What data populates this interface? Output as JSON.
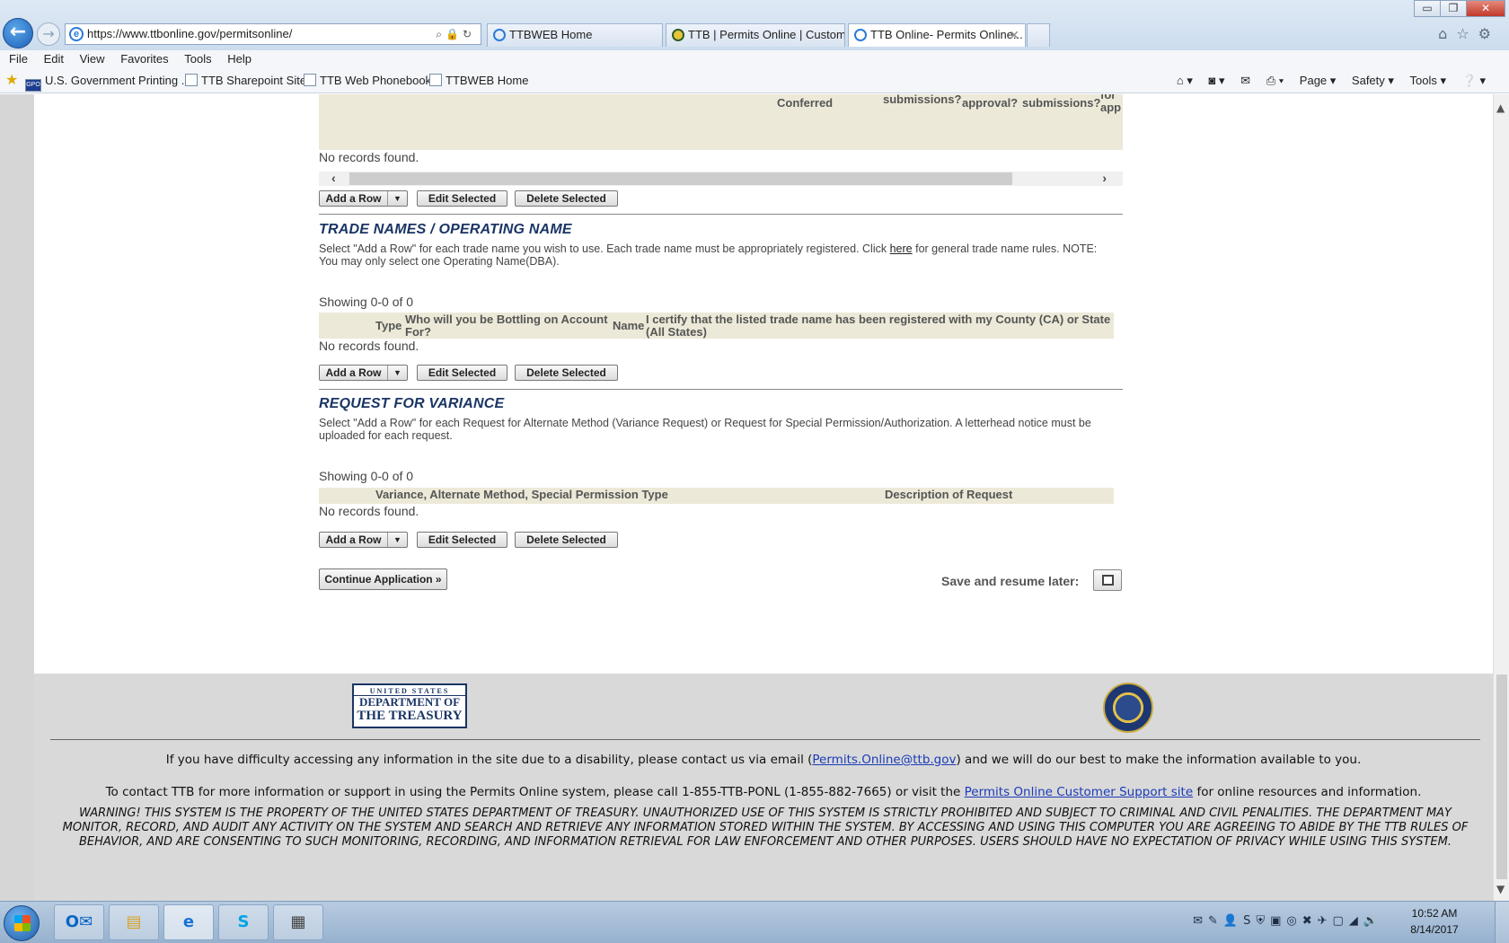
{
  "browser": {
    "url": "https://www.ttbonline.gov/permitsonline/",
    "tabs": [
      {
        "label": "TTBWEB Home"
      },
      {
        "label": "TTB | Permits Online | Custom..."
      },
      {
        "label": "TTB Online- Permits Online..."
      }
    ],
    "menu": [
      "File",
      "Edit",
      "View",
      "Favorites",
      "Tools",
      "Help"
    ],
    "favorites": [
      "U.S. Government Printing ...",
      "TTB Sharepoint Site",
      "TTB Web Phonebook",
      "TTBWEB Home"
    ],
    "command_bar": [
      "Page ▾",
      "Safety ▾",
      "Tools ▾"
    ]
  },
  "top_table": {
    "headers": [
      "Conferred",
      "submissions?",
      "approval?",
      "submissions?",
      "for app"
    ],
    "no_records": "No records found.",
    "add_row": "Add a Row",
    "edit_selected": "Edit Selected",
    "delete_selected": "Delete Selected"
  },
  "trade_names": {
    "title": "TRADE NAMES / OPERATING NAME",
    "desc_before": "Select \"Add a Row\" for each trade name you wish to use. Each trade name must be appropriately registered. Click ",
    "desc_link": "here",
    "desc_after": " for general trade name rules. NOTE: You may only select one Operating Name(DBA).",
    "showing": "Showing 0-0 of 0",
    "columns": [
      "Type",
      "Who will you be Bottling on Account For?",
      "Name",
      "I certify that the listed trade name has been registered with my County (CA) or State (All States)"
    ],
    "no_records": "No records found.",
    "add_row": "Add a Row",
    "edit_selected": "Edit Selected",
    "delete_selected": "Delete Selected"
  },
  "variance": {
    "title": "REQUEST FOR VARIANCE",
    "desc": "Select \"Add a Row\" for each Request for Alternate Method (Variance Request) or Request for Special Permission/Authorization. A letterhead notice must be uploaded for each request.",
    "showing": "Showing 0-0 of 0",
    "columns": [
      "Variance, Alternate Method, Special Permission Type",
      "Description of Request"
    ],
    "no_records": "No records found.",
    "add_row": "Add a Row",
    "edit_selected": "Edit Selected",
    "delete_selected": "Delete Selected"
  },
  "actions": {
    "continue": "Continue Application »",
    "save_label": "Save and resume later:"
  },
  "footer": {
    "treasury": {
      "line1": "UNITED STATES",
      "line2": "DEPARTMENT OF",
      "line3": "THE TREASURY"
    },
    "accessibility_before": "If you have difficulty accessing any information in the site due to a disability, please contact us via email (",
    "accessibility_email": "Permits.Online@ttb.gov",
    "accessibility_after": ") and we will do our best to make the information available to you.",
    "contact_before": "To contact TTB for more information or support in using the Permits Online system, please call 1-855-TTB-PONL (1-855-882-7665) or visit the ",
    "contact_link": "Permits Online Customer Support site",
    "contact_after": " for online resources and information.",
    "warning": "WARNING! THIS SYSTEM IS THE PROPERTY OF THE UNITED STATES DEPARTMENT OF TREASURY. UNAUTHORIZED USE OF THIS SYSTEM IS STRICTLY PROHIBITED AND SUBJECT TO CRIMINAL AND CIVIL PENALITIES. THE DEPARTMENT MAY MONITOR, RECORD, AND AUDIT ANY ACTIVITY ON THE SYSTEM AND SEARCH AND RETRIEVE ANY INFORMATION STORED WITHIN THE SYSTEM. BY ACCESSING AND USING THIS COMPUTER YOU ARE AGREEING TO ABIDE BY THE TTB RULES OF BEHAVIOR, AND ARE CONSENTING TO SUCH MONITORING, RECORDING, AND INFORMATION RETRIEVAL FOR LAW ENFORCEMENT AND OTHER PURPOSES. USERS SHOULD HAVE NO EXPECTATION OF PRIVACY WHILE USING THIS SYSTEM."
  },
  "taskbar": {
    "time": "10:52 AM",
    "date": "8/14/2017"
  },
  "colors": {
    "section_title": "#1a3565",
    "table_header_bg": "#ece9d8",
    "footer_bg": "#d9d9d9",
    "link": "#1a3bb8"
  }
}
